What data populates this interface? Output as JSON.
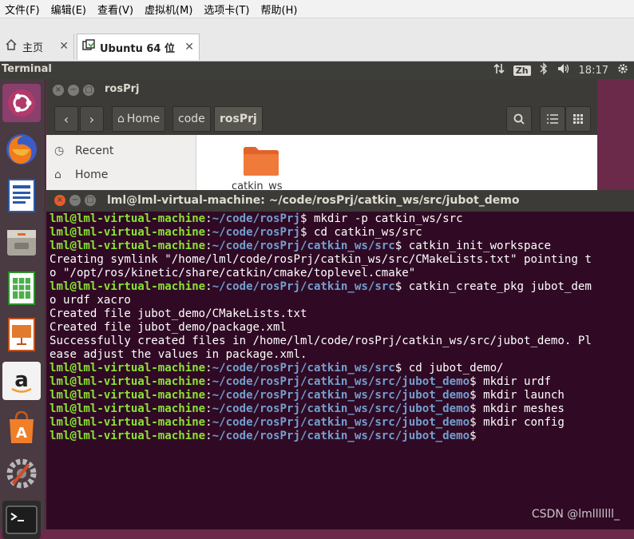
{
  "vm_menubar": {
    "items": [
      "文件(F)",
      "编辑(E)",
      "查看(V)",
      "虚拟机(M)",
      "选项卡(T)",
      "帮助(H)"
    ]
  },
  "vm_tabs": {
    "home_label": "主页",
    "ubuntu_label": "Ubuntu 64 位",
    "close_glyph": "✕"
  },
  "ubuntu_panel": {
    "app_title": "Terminal",
    "input_method": "Zh",
    "time": "18:17"
  },
  "launcher": {
    "items": [
      "ubuntu-dash",
      "firefox",
      "libreoffice-writer",
      "files",
      "libreoffice-calc",
      "libreoffice-impress",
      "amazon",
      "ubuntu-software",
      "system-settings",
      "terminal"
    ]
  },
  "file_manager": {
    "title": "rosPrj",
    "breadcrumbs": [
      "Home",
      "code",
      "rosPrj"
    ],
    "sidebar": [
      "Recent",
      "Home"
    ],
    "folder_name": "catkin_ws"
  },
  "terminal": {
    "title": "lml@lml-virtual-machine: ~/code/rosPrj/catkin_ws/src/jubot_demo",
    "lines": [
      {
        "type": "prompt",
        "user": "lml@lml-virtual-machine",
        "path": "~/code/rosPrj",
        "cmd": "$ mkdir -p catkin_ws/src"
      },
      {
        "type": "prompt",
        "user": "lml@lml-virtual-machine",
        "path": "~/code/rosPrj",
        "cmd": "$ cd catkin_ws/src"
      },
      {
        "type": "prompt",
        "user": "lml@lml-virtual-machine",
        "path": "~/code/rosPrj/catkin_ws/src",
        "cmd": "$ catkin_init_workspace"
      },
      {
        "type": "output",
        "text": "Creating symlink \"/home/lml/code/rosPrj/catkin_ws/src/CMakeLists.txt\" pointing t"
      },
      {
        "type": "output",
        "text": "o \"/opt/ros/kinetic/share/catkin/cmake/toplevel.cmake\""
      },
      {
        "type": "prompt",
        "user": "lml@lml-virtual-machine",
        "path": "~/code/rosPrj/catkin_ws/src",
        "cmd": "$ catkin_create_pkg jubot_dem"
      },
      {
        "type": "output",
        "text": "o urdf xacro"
      },
      {
        "type": "output",
        "text": "Created file jubot_demo/CMakeLists.txt"
      },
      {
        "type": "output",
        "text": "Created file jubot_demo/package.xml"
      },
      {
        "type": "output",
        "text": "Successfully created files in /home/lml/code/rosPrj/catkin_ws/src/jubot_demo. Pl"
      },
      {
        "type": "output",
        "text": "ease adjust the values in package.xml."
      },
      {
        "type": "prompt",
        "user": "lml@lml-virtual-machine",
        "path": "~/code/rosPrj/catkin_ws/src",
        "cmd": "$ cd jubot_demo/"
      },
      {
        "type": "prompt",
        "user": "lml@lml-virtual-machine",
        "path": "~/code/rosPrj/catkin_ws/src/jubot_demo",
        "cmd": "$ mkdir urdf"
      },
      {
        "type": "prompt",
        "user": "lml@lml-virtual-machine",
        "path": "~/code/rosPrj/catkin_ws/src/jubot_demo",
        "cmd": "$ mkdir launch"
      },
      {
        "type": "prompt",
        "user": "lml@lml-virtual-machine",
        "path": "~/code/rosPrj/catkin_ws/src/jubot_demo",
        "cmd": "$ mkdir meshes"
      },
      {
        "type": "prompt",
        "user": "lml@lml-virtual-machine",
        "path": "~/code/rosPrj/catkin_ws/src/jubot_demo",
        "cmd": "$ mkdir config"
      },
      {
        "type": "prompt",
        "user": "lml@lml-virtual-machine",
        "path": "~/code/rosPrj/catkin_ws/src/jubot_demo",
        "cmd": "$"
      }
    ]
  },
  "watermark": "CSDN @lmlllllll_",
  "colors": {
    "terminal_bg": "#300a24",
    "prompt_user": "#8ae234",
    "prompt_path": "#729fcf",
    "ubuntu_orange": "#e65a2c"
  }
}
